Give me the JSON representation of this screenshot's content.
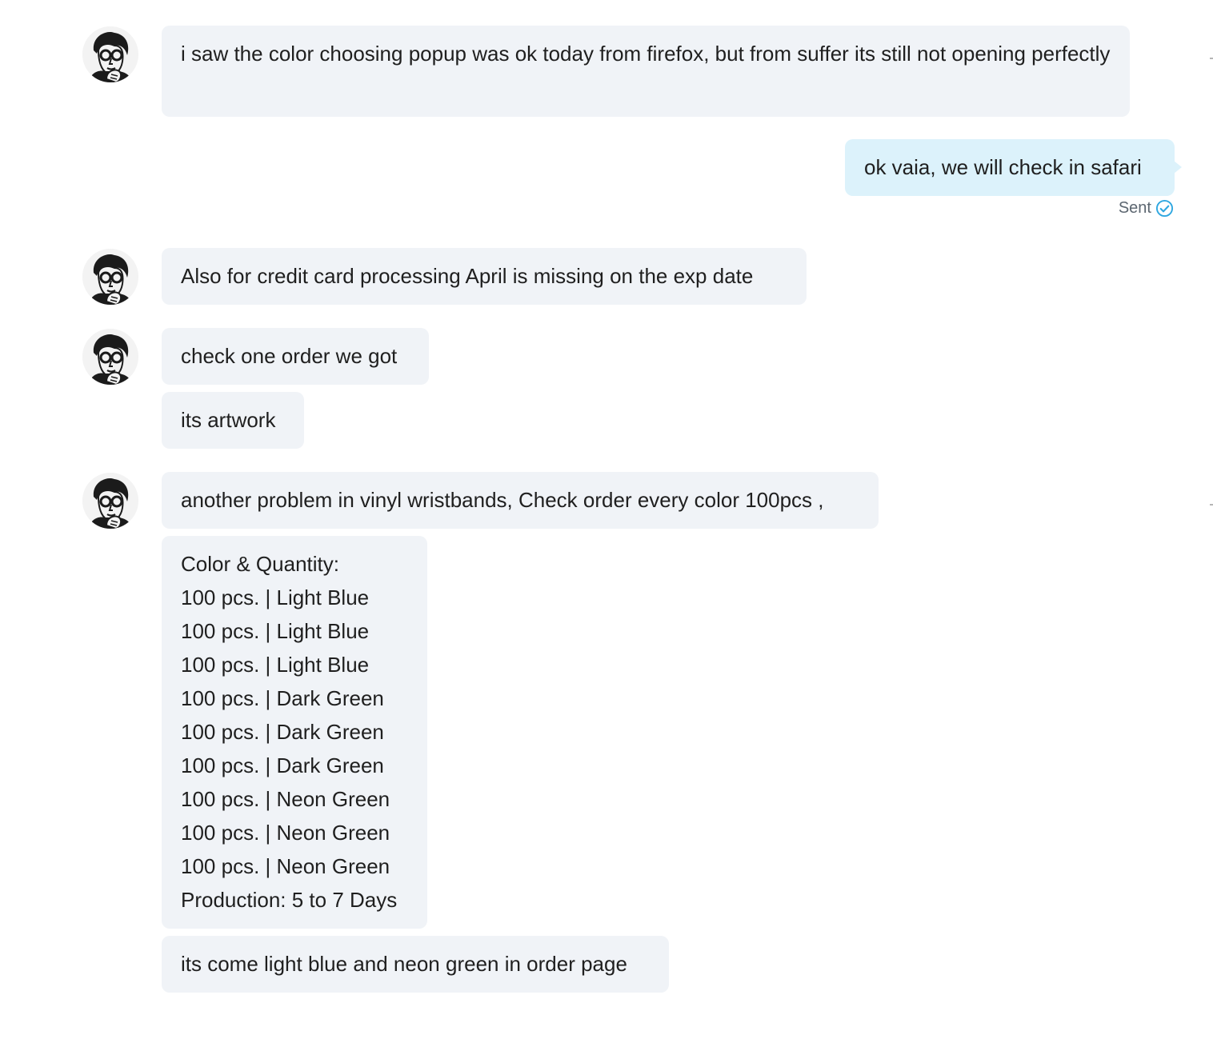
{
  "conversation": {
    "messages": [
      {
        "text": "i saw the color choosing popup was ok today from firefox, but from suffer its still not opening perfectly"
      },
      {
        "text": "ok vaia, we will check in safari",
        "status": "Sent"
      },
      {
        "text": "Also for credit card processing April is missing on the exp date"
      },
      {
        "text": "check one order we got"
      },
      {
        "text": "its artwork"
      },
      {
        "text": "another problem in vinyl wristbands, Check order every color 100pcs ,"
      },
      {
        "lines": [
          "Color & Quantity:",
          "100 pcs. | Light Blue",
          "100 pcs. | Light Blue",
          "100 pcs. | Light Blue",
          "100 pcs. | Dark Green",
          "100 pcs. | Dark Green",
          "100 pcs. | Dark Green",
          "100 pcs. | Neon Green",
          "100 pcs. | Neon Green",
          "100 pcs. | Neon Green",
          "Production: 5 to 7 Days"
        ]
      },
      {
        "text": "its come light blue and neon green in order page"
      }
    ]
  },
  "colors": {
    "incoming_bubble": "#f0f3f7",
    "outgoing_bubble": "#dcf2fb",
    "sent_check": "#2fa7e0"
  },
  "icons": {
    "avatar": "contact-avatar-icon",
    "sent": "check-circle-icon"
  }
}
